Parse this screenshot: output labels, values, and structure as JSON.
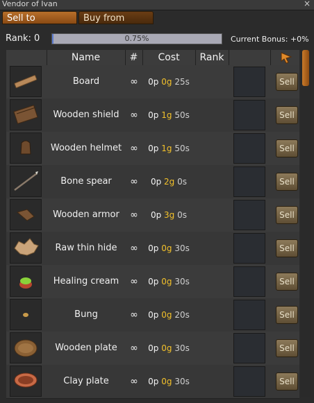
{
  "window": {
    "title": "Vendor of Ivan",
    "close_glyph": "×"
  },
  "tabs": [
    {
      "label": "Sell to"
    },
    {
      "label": "Buy from"
    }
  ],
  "rank": {
    "label": "Rank: 0",
    "progress_text": "0.75%",
    "progress_fraction": 0.0075,
    "bonus": "Current Bonus: +0%"
  },
  "columns": {
    "name": "Name",
    "qty": "#",
    "cost": "Cost",
    "rank": "Rank"
  },
  "sort_icon": "cursor-arrow-icon",
  "sell_label": "Sell",
  "items": [
    {
      "name": "Board",
      "qty": "∞",
      "p": "0p",
      "g": "0g",
      "s": "25s",
      "icon": "board-icon"
    },
    {
      "name": "Wooden shield",
      "qty": "∞",
      "p": "0p",
      "g": "1g",
      "s": "50s",
      "icon": "wooden-shield-icon"
    },
    {
      "name": "Wooden helmet",
      "qty": "∞",
      "p": "0p",
      "g": "1g",
      "s": "50s",
      "icon": "wooden-helmet-icon"
    },
    {
      "name": "Bone spear",
      "qty": "∞",
      "p": "0p",
      "g": "2g",
      "s": "0s",
      "icon": "bone-spear-icon"
    },
    {
      "name": "Wooden armor",
      "qty": "∞",
      "p": "0p",
      "g": "3g",
      "s": "0s",
      "icon": "wooden-armor-icon"
    },
    {
      "name": "Raw thin hide",
      "qty": "∞",
      "p": "0p",
      "g": "0g",
      "s": "30s",
      "icon": "raw-hide-icon"
    },
    {
      "name": "Healing cream",
      "qty": "∞",
      "p": "0p",
      "g": "0g",
      "s": "30s",
      "icon": "healing-cream-icon"
    },
    {
      "name": "Bung",
      "qty": "∞",
      "p": "0p",
      "g": "0g",
      "s": "20s",
      "icon": "bung-icon"
    },
    {
      "name": "Wooden plate",
      "qty": "∞",
      "p": "0p",
      "g": "0g",
      "s": "30s",
      "icon": "wooden-plate-icon"
    },
    {
      "name": "Clay plate",
      "qty": "∞",
      "p": "0p",
      "g": "0g",
      "s": "30s",
      "icon": "clay-plate-icon"
    }
  ],
  "colors": {
    "accent": "#b86f2a",
    "gold": "#f3c12a",
    "progress_fill": "#5a7ad0"
  }
}
